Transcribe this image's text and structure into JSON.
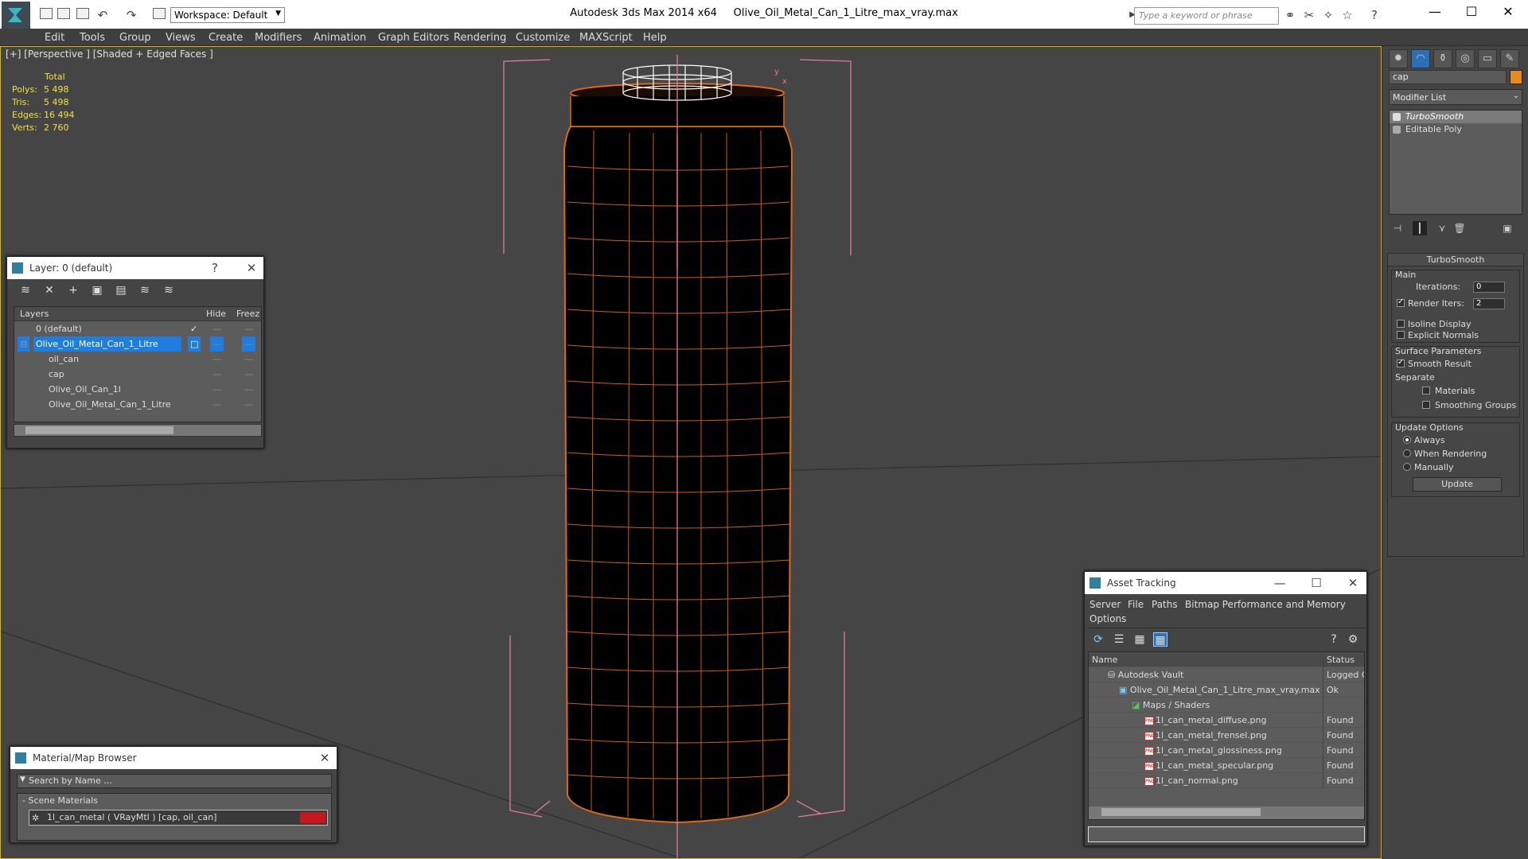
{
  "app": {
    "title": "Autodesk 3ds Max  2014 x64",
    "filename": "Olive_Oil_Metal_Can_1_Litre_max_vray.max",
    "workspace": "Workspace: Default",
    "search_placeholder": "Type a keyword or phrase"
  },
  "menu": [
    "Edit",
    "Tools",
    "Group",
    "Views",
    "Create",
    "Modifiers",
    "Animation",
    "Graph Editors",
    "Rendering",
    "Customize",
    "MAXScript",
    "Help"
  ],
  "viewport": {
    "label": "[+] [Perspective ] [Shaded + Edged Faces ]",
    "stats": {
      "header": "Total",
      "rows": [
        {
          "k": "Polys:",
          "v": "5 498"
        },
        {
          "k": "Tris:",
          "v": "5 498"
        },
        {
          "k": "Edges:",
          "v": "16 494"
        },
        {
          "k": "Verts:",
          "v": "2 760"
        }
      ]
    },
    "gizmo_x": "x",
    "gizmo_y": "y"
  },
  "command_panel": {
    "object_name": "cap",
    "object_color": "#e88b1a",
    "modifier_list": "Modifier List",
    "stack": [
      "TurboSmooth",
      "Editable Poly"
    ],
    "turbosmooth": {
      "title": "TurboSmooth",
      "main": "Main",
      "iterations_label": "Iterations:",
      "iterations": "0",
      "render_iters_label": "Render Iters:",
      "render_iters": "2",
      "isoline": "Isoline Display",
      "explicit_normals": "Explicit Normals",
      "surface_params": "Surface Parameters",
      "smooth_result": "Smooth Result",
      "separate": "Separate",
      "materials": "Materials",
      "smoothing_groups": "Smoothing Groups",
      "update_options": "Update Options",
      "always": "Always",
      "when_rendering": "When Rendering",
      "manually": "Manually",
      "update_btn": "Update"
    }
  },
  "layer_window": {
    "title": "Layer: 0 (default)",
    "help": "?",
    "col_layers": "Layers",
    "col_hide": "Hide",
    "col_freeze": "Freez",
    "rows": [
      "0 (default)",
      "Olive_Oil_Metal_Can_1_Litre",
      "oil_can",
      "cap",
      "Olive_Oil_Can_1l",
      "Olive_Oil_Metal_Can_1_Litre"
    ]
  },
  "material_browser": {
    "title": "Material/Map Browser",
    "search": "Search by Name ...",
    "group": "Scene Materials",
    "item": "1l_can_metal  ( VRayMtl ) [cap, oil_can]",
    "swatch_color": "#c8161d"
  },
  "asset_tracking": {
    "title": "Asset Tracking",
    "menu": [
      "Server",
      "File",
      "Paths",
      "Bitmap Performance and Memory",
      "Options"
    ],
    "col_name": "Name",
    "col_status": "Status",
    "rows": [
      {
        "name": "Autodesk Vault",
        "status": "Logged Out"
      },
      {
        "name": "Olive_Oil_Metal_Can_1_Litre_max_vray.max",
        "status": "Ok"
      },
      {
        "name": "Maps / Shaders",
        "status": ""
      },
      {
        "name": "1l_can_metal_diffuse.png",
        "status": "Found"
      },
      {
        "name": "1l_can_metal_frensel.png",
        "status": "Found"
      },
      {
        "name": "1l_can_metal_glossiness.png",
        "status": "Found"
      },
      {
        "name": "1l_can_metal_specular.png",
        "status": "Found"
      },
      {
        "name": "1l_can_normal.png",
        "status": "Found"
      }
    ]
  },
  "colors": {
    "accent_selection": "#1f7dde",
    "viewport_border": "#e3b700",
    "wire": "#e06a10",
    "stats_text": "#f0e040"
  }
}
